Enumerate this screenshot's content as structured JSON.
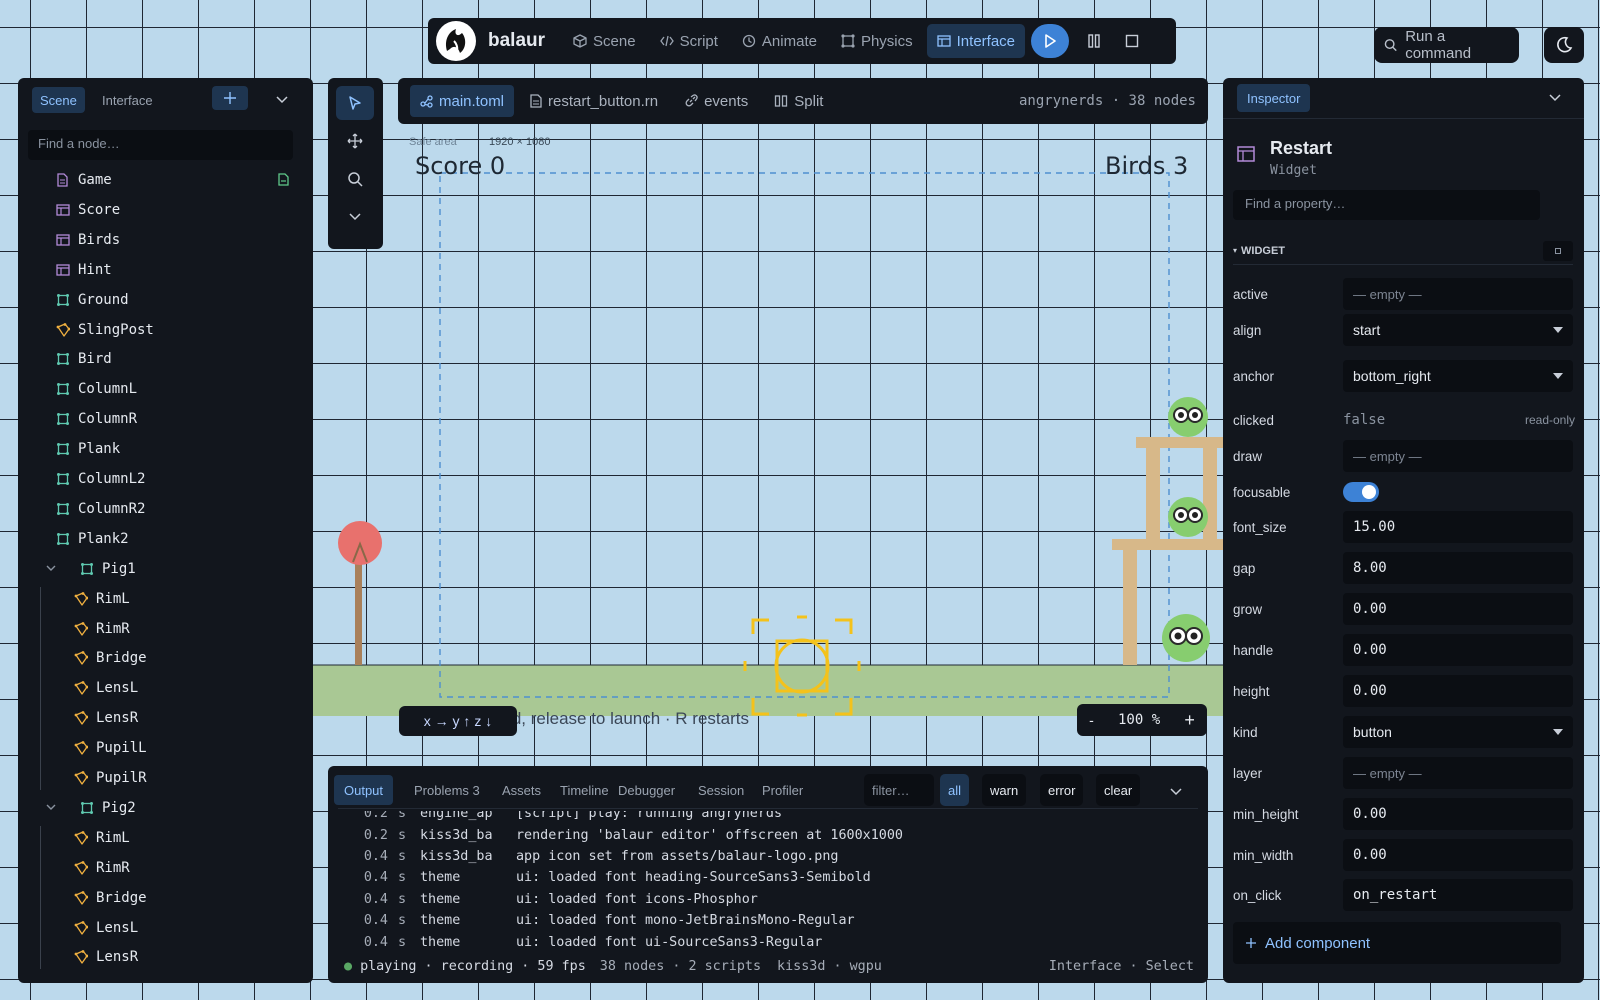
{
  "app": {
    "name": "balaur"
  },
  "topbar": {
    "tabs": [
      {
        "label": "Scene",
        "icon": "cube-icon"
      },
      {
        "label": "Script",
        "icon": "code-icon"
      },
      {
        "label": "Animate",
        "icon": "clock-icon"
      },
      {
        "label": "Physics",
        "icon": "joint-icon"
      },
      {
        "label": "Interface",
        "icon": "layout-icon",
        "active": true
      }
    ],
    "controls": {
      "play": "play-icon",
      "pause": "pause-icon",
      "stop": "stop-icon"
    },
    "command_label": "Run a command",
    "theme_icon": "moon-icon"
  },
  "left_panel": {
    "tabs": [
      "Scene",
      "Interface"
    ],
    "add_icon": "plus-icon",
    "search_placeholder": "Find a node…",
    "nodes": [
      {
        "label": "Game",
        "icon": "file-icon",
        "depth": 0
      },
      {
        "label": "Score",
        "icon": "widget-icon",
        "depth": 0
      },
      {
        "label": "Birds",
        "icon": "widget-icon",
        "depth": 0
      },
      {
        "label": "Hint",
        "icon": "widget-icon",
        "depth": 0
      },
      {
        "label": "Ground",
        "icon": "body-icon",
        "depth": 0
      },
      {
        "label": "SlingPost",
        "icon": "shape-icon",
        "depth": 0
      },
      {
        "label": "Bird",
        "icon": "body-icon",
        "depth": 0
      },
      {
        "label": "ColumnL",
        "icon": "body-icon",
        "depth": 0
      },
      {
        "label": "ColumnR",
        "icon": "body-icon",
        "depth": 0
      },
      {
        "label": "Plank",
        "icon": "body-icon",
        "depth": 0
      },
      {
        "label": "ColumnL2",
        "icon": "body-icon",
        "depth": 0
      },
      {
        "label": "ColumnR2",
        "icon": "body-icon",
        "depth": 0
      },
      {
        "label": "Plank2",
        "icon": "body-icon",
        "depth": 0
      },
      {
        "label": "Pig1",
        "icon": "body-icon",
        "depth": 0,
        "expanded": true
      },
      {
        "label": "RimL",
        "icon": "shape-icon",
        "depth": 1
      },
      {
        "label": "RimR",
        "icon": "shape-icon",
        "depth": 1
      },
      {
        "label": "Bridge",
        "icon": "shape-icon",
        "depth": 1
      },
      {
        "label": "LensL",
        "icon": "shape-icon",
        "depth": 1
      },
      {
        "label": "LensR",
        "icon": "shape-icon",
        "depth": 1
      },
      {
        "label": "PupilL",
        "icon": "shape-icon",
        "depth": 1
      },
      {
        "label": "PupilR",
        "icon": "shape-icon",
        "depth": 1
      },
      {
        "label": "Pig2",
        "icon": "body-icon",
        "depth": 0,
        "expanded": true
      },
      {
        "label": "RimL",
        "icon": "shape-icon",
        "depth": 1
      },
      {
        "label": "RimR",
        "icon": "shape-icon",
        "depth": 1
      },
      {
        "label": "Bridge",
        "icon": "shape-icon",
        "depth": 1
      },
      {
        "label": "LensL",
        "icon": "shape-icon",
        "depth": 1
      },
      {
        "label": "LensR",
        "icon": "shape-icon",
        "depth": 1
      }
    ]
  },
  "tools": [
    "cursor-icon",
    "move-icon",
    "search-icon",
    "chevron-down-icon"
  ],
  "editor": {
    "tabs": [
      {
        "label": "main.toml",
        "icon": "graph-icon",
        "active": true
      },
      {
        "label": "restart_button.rn",
        "icon": "file-icon"
      },
      {
        "label": "events",
        "icon": "link-icon"
      },
      {
        "label": "Split",
        "icon": "columns-icon"
      }
    ],
    "info": "angrynerds · 38 nodes"
  },
  "viewport": {
    "safe_area_label": "Safe area",
    "resolution": "1920 × 1080",
    "score": "Score 0",
    "birds": "Birds 3",
    "hint": "Drag the bird, release to launch · R restarts",
    "axis_labels": "x → y ↑ z ↓",
    "zoom": "100 %",
    "zoom_minus": "-",
    "zoom_plus": "+",
    "colors": {
      "sky": "#bcd9ec",
      "ground": "#a9c894",
      "wood": "#d7b889",
      "bird": "#e8716d",
      "pig": "#87cd6f",
      "gizmo": "#f4c21b",
      "safe": "#4e8fd0"
    }
  },
  "output": {
    "tabs": [
      "Output",
      "Problems 3",
      "Assets",
      "Timeline",
      "Debugger",
      "Session",
      "Profiler"
    ],
    "filter_placeholder": "filter…",
    "levels": [
      "all",
      "warn",
      "error"
    ],
    "clear_label": "clear",
    "log": [
      {
        "t": "0.2",
        "u": "s",
        "src": "engine_ap",
        "msg": "[script] play: running angrynerds"
      },
      {
        "t": "0.2",
        "u": "s",
        "src": "kiss3d_ba",
        "msg": "rendering 'balaur editor' offscreen at 1600x1000"
      },
      {
        "t": "0.4",
        "u": "s",
        "src": "kiss3d_ba",
        "msg": "app icon set from assets/balaur-logo.png"
      },
      {
        "t": "0.4",
        "u": "s",
        "src": "theme",
        "msg": "ui: loaded font heading-SourceSans3-Semibold"
      },
      {
        "t": "0.4",
        "u": "s",
        "src": "theme",
        "msg": "ui: loaded font icons-Phosphor"
      },
      {
        "t": "0.4",
        "u": "s",
        "src": "theme",
        "msg": "ui: loaded font mono-JetBrainsMono-Regular"
      },
      {
        "t": "0.4",
        "u": "s",
        "src": "theme",
        "msg": "ui: loaded font ui-SourceSans3-Regular"
      }
    ],
    "status": {
      "state": "playing · recording · 59 fps",
      "nodes": "38 nodes · 2 scripts",
      "backend": "kiss3d · wgpu",
      "mode": "Interface · Select"
    }
  },
  "inspector": {
    "tab": "Inspector",
    "title": "Restart",
    "subtitle": "Widget",
    "search_placeholder": "Find a property…",
    "section": "WIDGET",
    "props": [
      {
        "label": "active",
        "kind": "empty",
        "value": "— empty —"
      },
      {
        "label": "align",
        "kind": "select",
        "value": "start"
      },
      {
        "label": "anchor",
        "kind": "select",
        "value": "bottom_right"
      },
      {
        "label": "clicked",
        "kind": "readonly",
        "value": "false",
        "note": "read-only"
      },
      {
        "label": "draw",
        "kind": "empty",
        "value": "— empty —"
      },
      {
        "label": "focusable",
        "kind": "toggle",
        "value": true
      },
      {
        "label": "font_size",
        "kind": "number",
        "value": "15.00"
      },
      {
        "label": "gap",
        "kind": "number",
        "value": "8.00"
      },
      {
        "label": "grow",
        "kind": "number",
        "value": "0.00"
      },
      {
        "label": "handle",
        "kind": "number",
        "value": "0.00"
      },
      {
        "label": "height",
        "kind": "number",
        "value": "0.00"
      },
      {
        "label": "kind",
        "kind": "select",
        "value": "button"
      },
      {
        "label": "layer",
        "kind": "empty",
        "value": "— empty —"
      },
      {
        "label": "min_height",
        "kind": "number",
        "value": "0.00"
      },
      {
        "label": "min_width",
        "kind": "number",
        "value": "0.00"
      },
      {
        "label": "on_click",
        "kind": "number",
        "value": "on_restart"
      }
    ],
    "add_component": "Add component",
    "accent": "#8fc2ff"
  }
}
